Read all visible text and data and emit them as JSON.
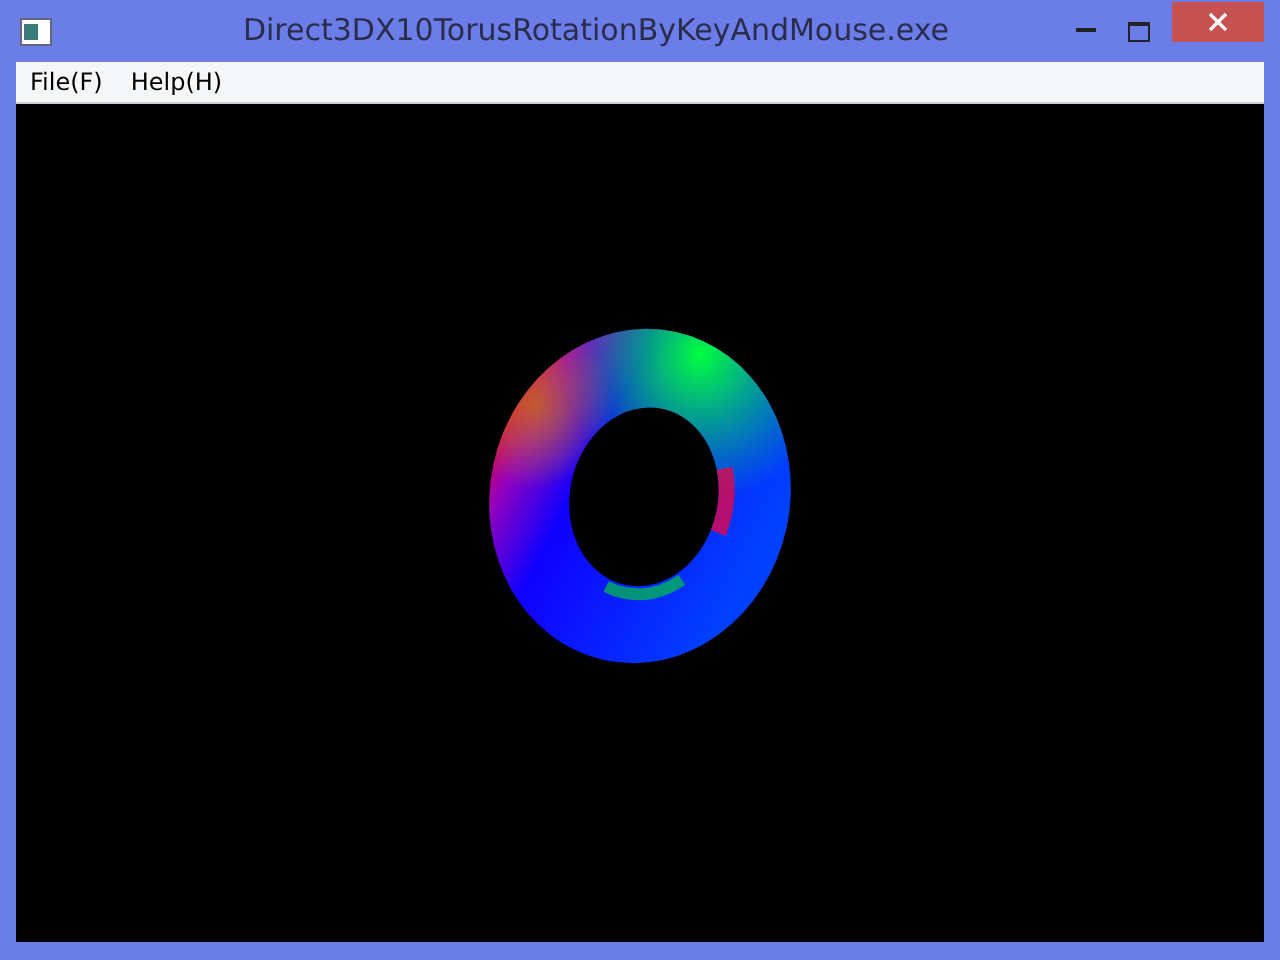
{
  "window": {
    "title": "Direct3DX10TorusRotationByKeyAndMouse.exe"
  },
  "menu": [
    {
      "label": "File(F)"
    },
    {
      "label": "Help(H)"
    }
  ]
}
